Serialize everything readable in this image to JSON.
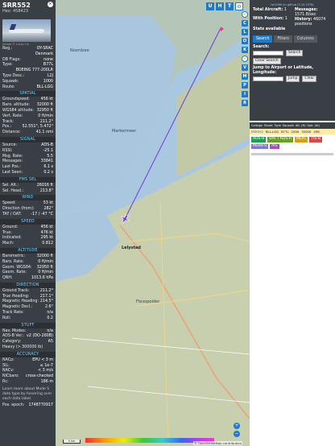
{
  "aircraft": {
    "callsign": "SRR552",
    "hex": "Hex: 458423",
    "photo_credit": "Image © Lucky Lin",
    "close_icon": "×",
    "basic": [
      {
        "k": "Reg.:",
        "v": "OY-SRAC"
      },
      {
        "k": "",
        "v": "Denmark"
      },
      {
        "k": "DB Flags:",
        "v": "none"
      },
      {
        "k": "Type:",
        "v": "B77L"
      },
      {
        "k": "",
        "v": "BOEING 777-200LR"
      },
      {
        "k": "Type Desc.:",
        "v": "L2J"
      },
      {
        "k": "Squawk:",
        "v": "1000"
      },
      {
        "k": "Route:",
        "v": "BLL-LGG"
      }
    ],
    "sections": [
      {
        "title": "SPATIAL",
        "rows": [
          {
            "k": "Groundspeed:",
            "v": "456 kt"
          },
          {
            "k": "Baro. altitude:",
            "v": "32000 ft"
          },
          {
            "k": "WGS84 altitude:",
            "v": "32950 ft"
          },
          {
            "k": "Vert. Rate:",
            "v": "0 ft/min"
          },
          {
            "k": "Track:",
            "v": "211.2°"
          },
          {
            "k": "Pos.:",
            "v": "52.551°, 5.472°"
          },
          {
            "k": "Distance:",
            "v": "41.1 nmi"
          }
        ]
      },
      {
        "title": "SIGNAL",
        "rows": [
          {
            "k": "Source:",
            "v": "ADS-B"
          },
          {
            "k": "RSSI:",
            "v": "-25.1"
          },
          {
            "k": "Msg. Rate:",
            "v": "5.5"
          },
          {
            "k": "Messages:",
            "v": "33841"
          },
          {
            "k": "Last Pos.:",
            "v": "6.1 s"
          },
          {
            "k": "Last Seen:",
            "v": "0.2 s"
          }
        ]
      },
      {
        "title": "FMS SEL",
        "rows": [
          {
            "k": "Sel. Alt.:",
            "v": "26016 ft"
          },
          {
            "k": "Sel. Head.:",
            "v": "213.8°"
          }
        ]
      },
      {
        "title": "WIND",
        "rows": [
          {
            "k": "Speed:",
            "v": "53 kt"
          },
          {
            "k": "Direction (from):",
            "v": "282°"
          },
          {
            "k": "TAT / OAT:",
            "v": "-17 / -47 °C"
          }
        ]
      },
      {
        "title": "SPEED",
        "rows": [
          {
            "k": "Ground:",
            "v": "456 kt"
          },
          {
            "k": "True:",
            "v": "476 kt"
          },
          {
            "k": "Indicated:",
            "v": "295 kt"
          },
          {
            "k": "Mach:",
            "v": "0.812"
          }
        ]
      },
      {
        "title": "ALTITUDE",
        "rows": [
          {
            "k": "Barometric:",
            "v": "32000 ft"
          },
          {
            "k": "Baro. Rate:",
            "v": "0 ft/min"
          },
          {
            "k": "Geom. WGS84:",
            "v": "32950 ft"
          },
          {
            "k": "Geom. Rate:",
            "v": "0 ft/min"
          },
          {
            "k": "QNH:",
            "v": "1013.6 hPa"
          }
        ]
      },
      {
        "title": "DIRECTION",
        "rows": [
          {
            "k": "Ground Track:",
            "v": "211.2°"
          },
          {
            "k": "True Heading:",
            "v": "217.1°"
          },
          {
            "k": "Magnetic Heading:",
            "v": "214.5°"
          },
          {
            "k": "Magnetic Decl.:",
            "v": "2.6°"
          },
          {
            "k": "Track Rate:",
            "v": "n/a"
          },
          {
            "k": "Roll:",
            "v": "0.2"
          }
        ]
      },
      {
        "title": "STUFF",
        "rows": [
          {
            "k": "Nav. Modes:",
            "v": "n/a"
          },
          {
            "k": "ADS-B Ver.:",
            "v": "v2 (DO-260B)"
          },
          {
            "k": "Category:",
            "v": "A5"
          },
          {
            "k": "Heavy (> 300000 lb)",
            "v": ""
          }
        ]
      },
      {
        "title": "ACCURACY",
        "rows": [
          {
            "k": "NACp:",
            "v": "EPU < 3 m"
          },
          {
            "k": "SIL:",
            "v": "≤ 1e-7"
          },
          {
            "k": "NACv:",
            "v": "< 3 m/s"
          },
          {
            "k": "NICbaro:",
            "v": "cross-checked"
          },
          {
            "k": "Rc:",
            "v": "186 m"
          }
        ]
      }
    ],
    "learn_more": "Learn more about Mode S data type by hovering over each data label.",
    "pos_epoch_k": "Pos. epoch:",
    "pos_epoch_v": "1748770917"
  },
  "right": {
    "version": "tar1090 on github (3.14.1578)",
    "stats": [
      {
        "k": "Total Aircraft:",
        "v": "1"
      },
      {
        "k": "With Position:",
        "v": "1"
      },
      {
        "k": "Messages:",
        "v": "1571.8/sec"
      },
      {
        "k": "History:",
        "v": "46074 positions"
      }
    ],
    "stats_available": "Stats available",
    "tabs": [
      "Search",
      "Filters",
      "Columns"
    ],
    "search_label": "Search:",
    "search_btn": "Search",
    "clear_search_btn": "Clear Search",
    "jump_label": "Jump to Airport or Latitude, Longitude:",
    "jump_btn": "Jump",
    "clear_btn": "Clear",
    "columns": [
      "Callsign",
      "Route",
      "Type",
      "Squawk",
      "Alt. (ft)",
      "Spd. (kt)"
    ],
    "row": [
      "SRR552",
      "BLL-LGG",
      "B77L",
      "1000",
      "32000",
      "456"
    ],
    "badges": [
      {
        "label": "ADS-B",
        "color": "#1f9e4c"
      },
      {
        "label": "UAT / ADS-R",
        "color": "#6c9e2c"
      },
      {
        "label": "MLAT",
        "color": "#d4a017"
      },
      {
        "label": "TIS-B",
        "color": "#d24b4b"
      },
      {
        "label": "Mode-S",
        "color": "#7a7ad1"
      },
      {
        "label": "AIS",
        "color": "#a44fb3"
      }
    ]
  },
  "map": {
    "labels": {
      "noord_holland": "Noordzee",
      "markermeer": "Markermeer",
      "lelystad": "Lelystad",
      "flevoland": "Flevopolder"
    },
    "scale": "5 km",
    "attribution": "© OpenStreetMap contributors",
    "top_tabs": [
      "U",
      "H",
      "T"
    ],
    "zoom_in": "+",
    "zoom_out": "−",
    "controls": [
      "C",
      "L",
      "O",
      "K",
      "V",
      "M",
      "P",
      "I",
      "R"
    ]
  }
}
